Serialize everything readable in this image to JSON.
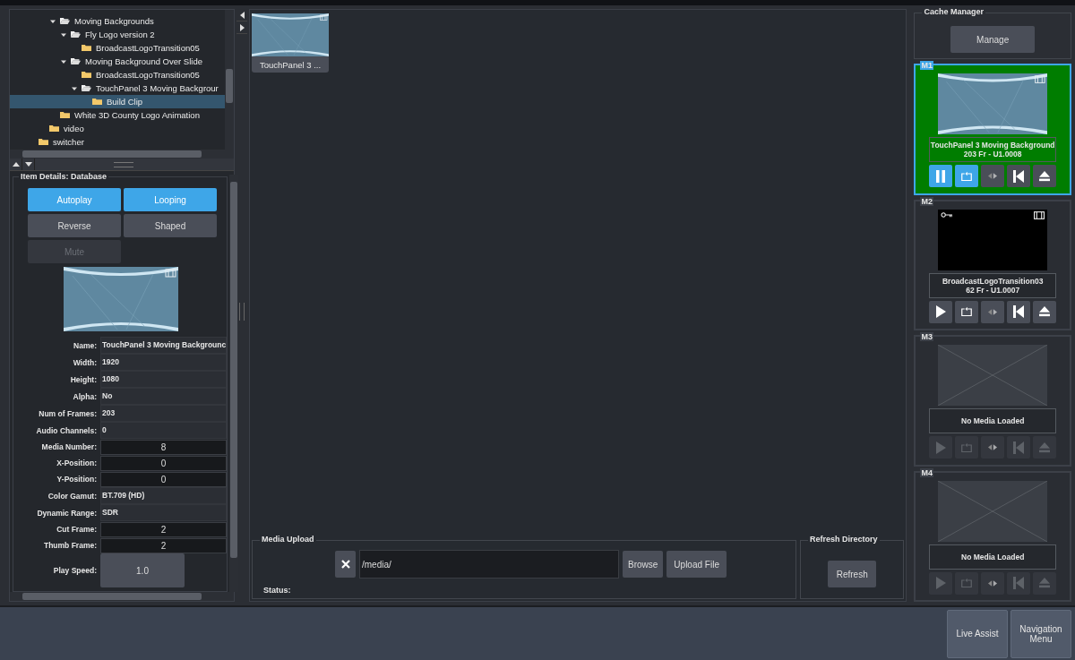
{
  "tree": [
    {
      "children": [
        {
          "children": [
            {
              "label": "Moving Backgrounds",
              "expanded": true,
              "selected": false,
              "children": [
                {
                  "label": "Fly Logo version 2",
                  "expanded": true,
                  "selected": false,
                  "children": [
                    {
                      "label": "BroadcastLogoTransition05",
                      "selected": false
                    }
                  ]
                },
                {
                  "label": "Moving Background Over Slide",
                  "expanded": true,
                  "selected": false,
                  "children": [
                    {
                      "label": "BroadcastLogoTransition05",
                      "selected": false
                    },
                    {
                      "label": "TouchPanel 3 Moving Backgrour",
                      "expanded": true,
                      "selected": false,
                      "children": [
                        {
                          "label": "Build Clip",
                          "selected": true
                        }
                      ]
                    }
                  ]
                }
              ]
            },
            {
              "label": "White 3D County Logo Animation",
              "selected": false
            }
          ]
        },
        {
          "label": "video",
          "selected": false
        }
      ]
    },
    {
      "label": "switcher",
      "selected": false
    }
  ],
  "details": {
    "title": "Item Details: Database",
    "toggles": [
      {
        "label": "Autoplay",
        "on": true,
        "disabled": false
      },
      {
        "label": "Looping",
        "on": true,
        "disabled": false
      },
      {
        "label": "Reverse",
        "on": false,
        "disabled": false
      },
      {
        "label": "Shaped",
        "on": false,
        "disabled": false
      },
      {
        "label": "Mute",
        "on": false,
        "disabled": true
      }
    ],
    "fields": [
      {
        "label": "Name:",
        "value": "TouchPanel 3 Moving Backgrounc",
        "kind": "text"
      },
      {
        "label": "Width:",
        "value": "1920",
        "kind": "text"
      },
      {
        "label": "Height:",
        "value": "1080",
        "kind": "text"
      },
      {
        "label": "Alpha:",
        "value": "No",
        "kind": "text"
      },
      {
        "label": "Num of Frames:",
        "value": "203",
        "kind": "text"
      },
      {
        "label": "Audio Channels:",
        "value": "0",
        "kind": "text"
      },
      {
        "label": "Media Number:",
        "value": "8",
        "kind": "input"
      },
      {
        "label": "X-Position:",
        "value": "0",
        "kind": "input"
      },
      {
        "label": "Y-Position:",
        "value": "0",
        "kind": "input"
      },
      {
        "label": "Color Gamut:",
        "value": "BT.709 (HD)",
        "kind": "text"
      },
      {
        "label": "Dynamic Range:",
        "value": "SDR",
        "kind": "text"
      },
      {
        "label": "Cut Frame:",
        "value": "2",
        "kind": "input"
      },
      {
        "label": "Thumb Frame:",
        "value": "2",
        "kind": "input"
      },
      {
        "label": "Play Speed:",
        "value": "1.0",
        "kind": "button"
      }
    ]
  },
  "media_items": [
    {
      "label": "TouchPanel 3 ...",
      "selected": false
    }
  ],
  "upload": {
    "title": "Media Upload",
    "path": "/media/",
    "browse": "Browse",
    "upload": "Upload File",
    "status_label": "Status:"
  },
  "refresh": {
    "title": "Refresh Directory",
    "button": "Refresh"
  },
  "cache": {
    "title": "Cache Manager",
    "button": "Manage"
  },
  "players": [
    {
      "id": "M1",
      "selected": true,
      "kind": "loaded",
      "dark": false,
      "keyed": false,
      "title": "TouchPanel 3 Moving Background",
      "info": "203 Fr - U1.0008",
      "playing": true,
      "looping": true
    },
    {
      "id": "M2",
      "selected": false,
      "kind": "loaded",
      "dark": true,
      "keyed": true,
      "title": "BroadcastLogoTransition03",
      "info": "62 Fr - U1.0007",
      "playing": false,
      "looping": false
    },
    {
      "id": "M3",
      "selected": false,
      "kind": "empty",
      "title": "No Media Loaded"
    },
    {
      "id": "M4",
      "selected": false,
      "kind": "empty",
      "title": "No Media Loaded"
    }
  ],
  "footer_buttons": [
    "Live Assist",
    "Navigation Menu"
  ]
}
